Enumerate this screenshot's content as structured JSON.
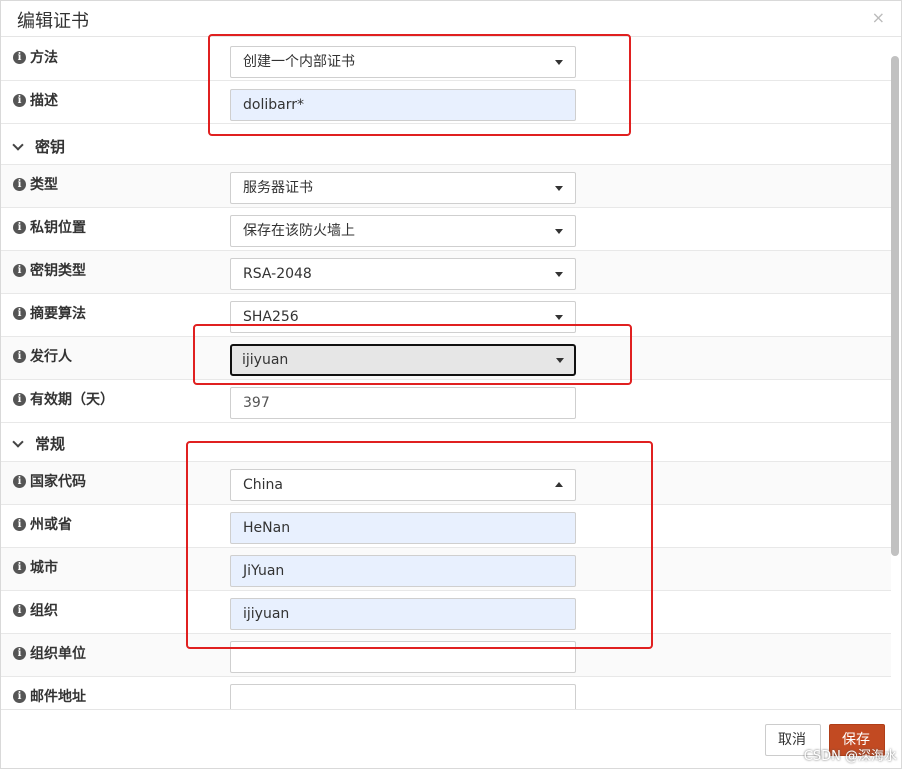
{
  "dialog": {
    "title": "编辑证书",
    "close_glyph": "×"
  },
  "fields": {
    "method": {
      "label": "方法",
      "value": "创建一个内部证书"
    },
    "description": {
      "label": "描述",
      "value": "dolibarr*"
    },
    "type": {
      "label": "类型",
      "value": "服务器证书"
    },
    "private_key_location": {
      "label": "私钥位置",
      "value": "保存在该防火墙上"
    },
    "key_type": {
      "label": "密钥类型",
      "value": "RSA-2048"
    },
    "digest_algorithm": {
      "label": "摘要算法",
      "value": "SHA256"
    },
    "issuer": {
      "label": "发行人",
      "value": "ijiyuan"
    },
    "lifetime": {
      "label": "有效期（天）",
      "value": "397"
    },
    "country_code": {
      "label": "国家代码",
      "value": "China"
    },
    "state": {
      "label": "州或省",
      "value": "HeNan"
    },
    "city": {
      "label": "城市",
      "value": "JiYuan"
    },
    "organization": {
      "label": "组织",
      "value": "ijiyuan"
    },
    "org_unit": {
      "label": "组织单位",
      "value": ""
    },
    "email": {
      "label": "邮件地址",
      "value": ""
    }
  },
  "sections": {
    "key": "密钥",
    "general": "常规"
  },
  "footer": {
    "cancel_label": "取消",
    "save_label": "保存"
  },
  "watermark": "CSDN @深海水",
  "colors": {
    "save_button": "#c24a22",
    "annotation_box": "#e02020",
    "autofill_bg": "#e8f0fe"
  }
}
